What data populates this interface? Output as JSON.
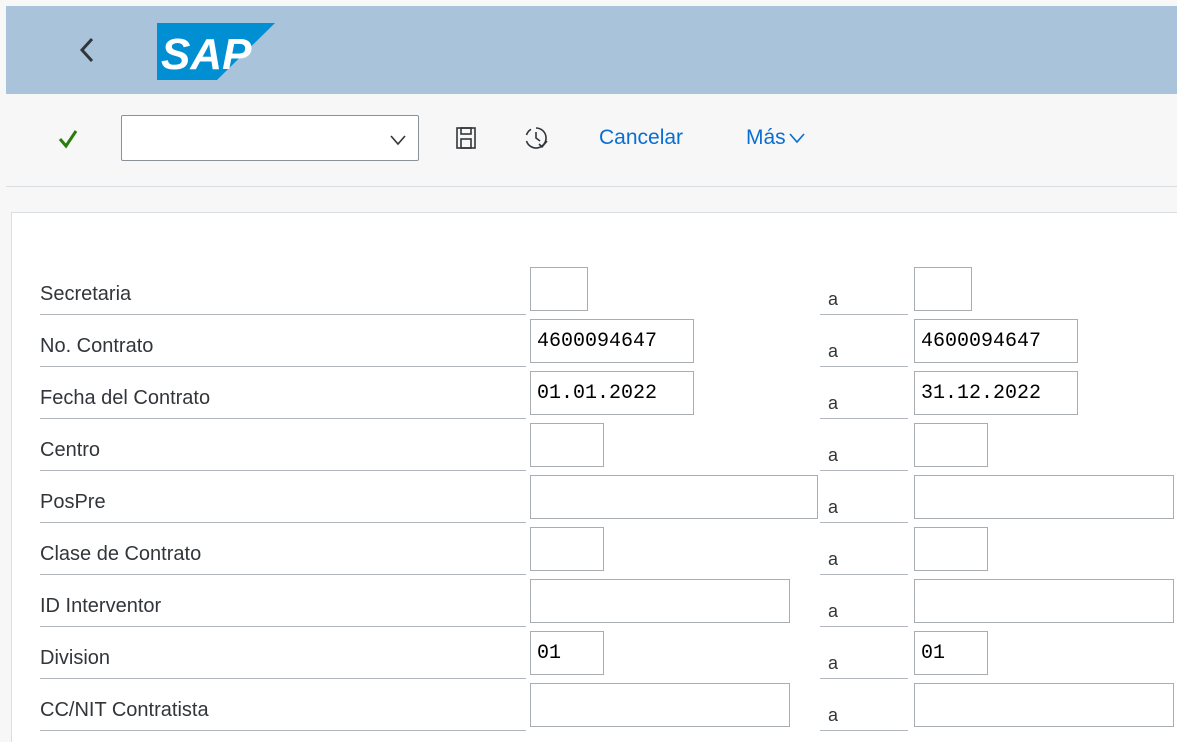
{
  "shell": {
    "logo_text": "SAP"
  },
  "toolbar": {
    "command_value": "",
    "cancel_label": "Cancelar",
    "more_label": "Más"
  },
  "icons": {
    "back": "back-chevron-icon",
    "check": "checkmark-icon",
    "dropdown": "chevron-down-icon",
    "save": "save-icon",
    "execute": "clock-execute-icon"
  },
  "colors": {
    "shell_bg": "#a9c3da",
    "accent": "#0a6ed1",
    "check": "#2b7c0f",
    "logo": "#008fd3"
  },
  "form": {
    "range_separator": "a",
    "rows": [
      {
        "label": "Secretaria",
        "from": "",
        "to": ""
      },
      {
        "label": "No. Contrato",
        "from": "4600094647",
        "to": "4600094647"
      },
      {
        "label": "Fecha del Contrato",
        "from": "01.01.2022",
        "to": "31.12.2022"
      },
      {
        "label": "Centro",
        "from": "",
        "to": ""
      },
      {
        "label": "PosPre",
        "from": "",
        "to": ""
      },
      {
        "label": "Clase de Contrato",
        "from": "",
        "to": ""
      },
      {
        "label": "ID Interventor",
        "from": "",
        "to": ""
      },
      {
        "label": "Division",
        "from": "01",
        "to": "01"
      },
      {
        "label": "CC/NIT Contratista",
        "from": "",
        "to": ""
      }
    ]
  }
}
